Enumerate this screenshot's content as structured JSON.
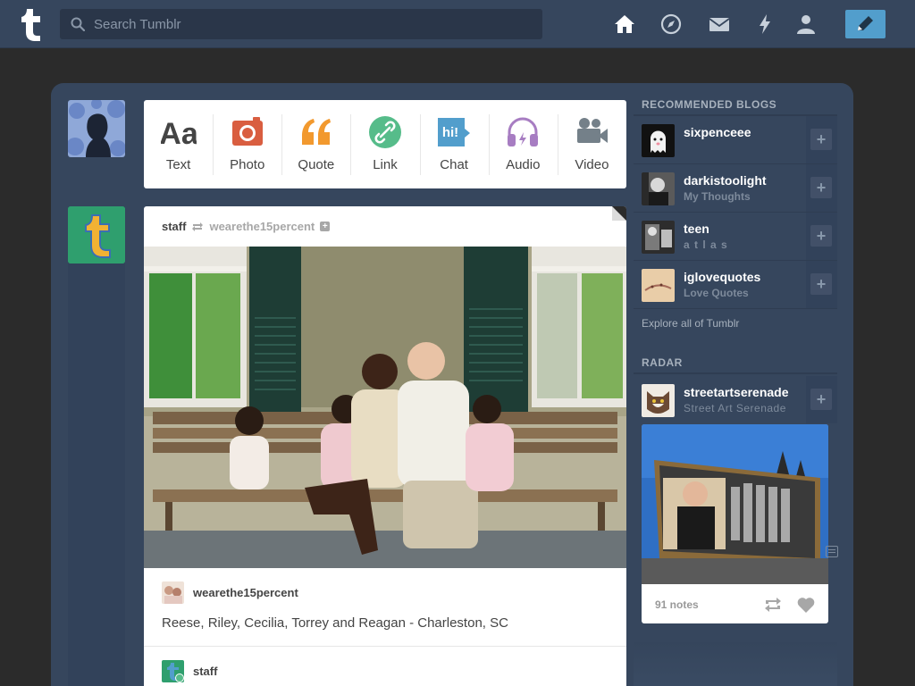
{
  "search": {
    "placeholder": "Search Tumblr"
  },
  "nav": {
    "icons": [
      "home-icon",
      "explore-icon",
      "inbox-icon",
      "activity-icon",
      "account-icon"
    ],
    "compose_icon": "pencil-icon"
  },
  "post_types": [
    {
      "label": "Text",
      "icon": "text-icon",
      "color": "#444444"
    },
    {
      "label": "Photo",
      "icon": "camera-icon",
      "color": "#d95e40"
    },
    {
      "label": "Quote",
      "icon": "quote-icon",
      "color": "#f2992e"
    },
    {
      "label": "Link",
      "icon": "link-icon",
      "color": "#56bc8a"
    },
    {
      "label": "Chat",
      "icon": "chat-icon",
      "color": "#529ecc"
    },
    {
      "label": "Audio",
      "icon": "headphones-icon",
      "color": "#a77dc2"
    },
    {
      "label": "Video",
      "icon": "video-camera-icon",
      "color": "#748089"
    }
  ],
  "post": {
    "author": "staff",
    "reblogged_from": "wearethe15percent",
    "reblog_source": "wearethe15percent",
    "caption": "Reese, Riley, Cecilia, Torrey and Reagan - Charleston, SC",
    "next_reblogger": "staff"
  },
  "sidebar": {
    "recommended_title": "RECOMMENDED BLOGS",
    "blogs": [
      {
        "name": "sixpenceee",
        "subtitle": ""
      },
      {
        "name": "darkistoolight",
        "subtitle": "My Thoughts"
      },
      {
        "name": "teen",
        "subtitle": "a t l a s"
      },
      {
        "name": "iglovequotes",
        "subtitle": "Love Quotes"
      }
    ],
    "explore_link": "Explore all of Tumblr",
    "radar_title": "RADAR",
    "radar": {
      "name": "streetartserenade",
      "subtitle": "Street Art Serenade",
      "notes": "91 notes"
    }
  },
  "colors": {
    "topbar": "#36465d",
    "accent": "#529ecc",
    "background": "#2b2b2b"
  }
}
